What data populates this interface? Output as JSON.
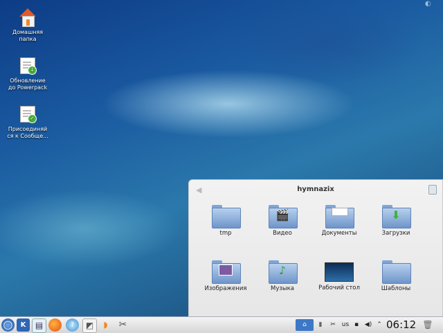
{
  "desktop": {
    "icons": [
      {
        "label": "Домашняя\nпапка",
        "icon": "home-folder-icon"
      },
      {
        "label": "Обновление\nдо Powerpack",
        "icon": "update-document-icon"
      },
      {
        "label": "Присоединяй\nся к Сообще...",
        "icon": "join-community-document-icon"
      }
    ]
  },
  "folderview": {
    "title": "hymnazix",
    "items": [
      {
        "label": "tmp"
      },
      {
        "label": "Видео"
      },
      {
        "label": "Документы"
      },
      {
        "label": "Загрузки"
      },
      {
        "label": "Изображения"
      },
      {
        "label": "Музыка"
      },
      {
        "label": "Рабочий стол"
      },
      {
        "label": "Шаблоны"
      }
    ]
  },
  "taskbar": {
    "keyboard_layout": "us",
    "clock": "06:12"
  }
}
